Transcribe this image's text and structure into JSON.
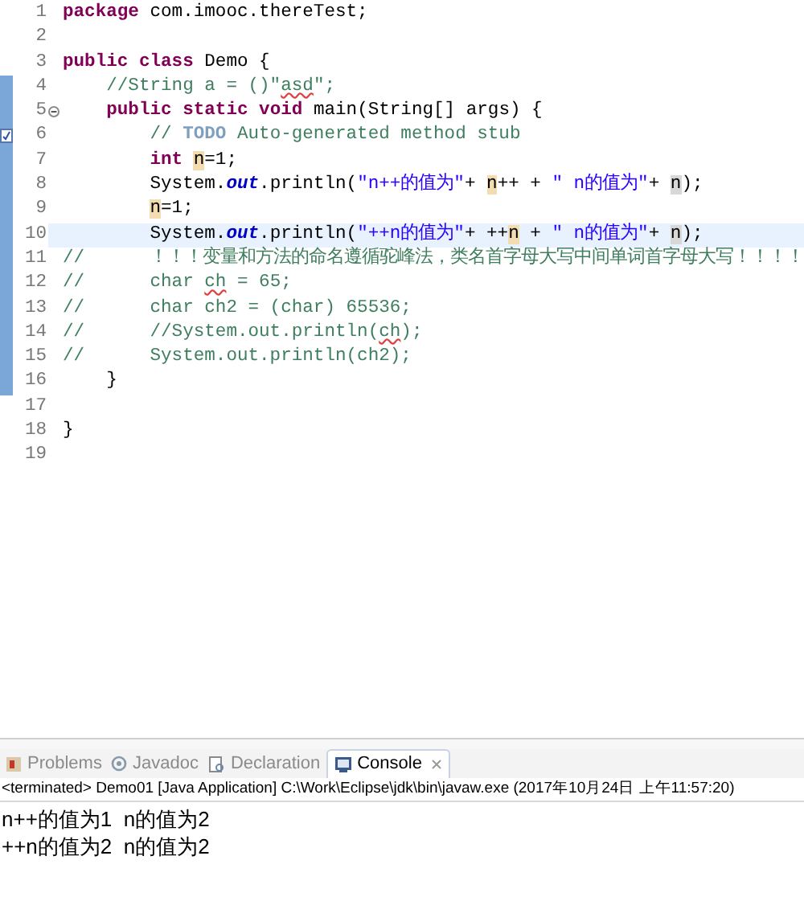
{
  "editor": {
    "lines": [
      {
        "number": "1",
        "changed": false,
        "current": false,
        "fold_toggle": false,
        "task_marker": false,
        "tokens": [
          {
            "kind": "keyword",
            "text": "package"
          },
          {
            "kind": "plain",
            "text": " com.imooc.thereTest;"
          }
        ]
      },
      {
        "number": "2",
        "changed": false,
        "current": false,
        "fold_toggle": false,
        "task_marker": false
      },
      {
        "number": "3",
        "changed": false,
        "current": false,
        "fold_toggle": false,
        "task_marker": false,
        "tokens": [
          {
            "kind": "keyword",
            "text": "public"
          },
          {
            "kind": "keyword",
            "text": " class"
          },
          {
            "kind": "plain",
            "text": " Demo {"
          }
        ]
      },
      {
        "number": "4",
        "changed": true,
        "current": false,
        "fold_toggle": false,
        "task_marker": false,
        "tokens": [
          {
            "kind": "comment",
            "text": "    //String a = ()\""
          },
          {
            "kind": "comment_misspelled",
            "text": "asd"
          },
          {
            "kind": "comment",
            "text": "\";"
          }
        ]
      },
      {
        "number": "5",
        "changed": true,
        "current": false,
        "fold_toggle": true,
        "task_marker": false,
        "tokens": [
          {
            "kind": "keyword",
            "text": "    public"
          },
          {
            "kind": "keyword",
            "text": " static"
          },
          {
            "kind": "keyword",
            "text": " void"
          },
          {
            "kind": "plain",
            "text": " main(String[] args) {"
          }
        ]
      },
      {
        "number": "6",
        "changed": true,
        "current": false,
        "fold_toggle": false,
        "task_marker": true,
        "tokens": [
          {
            "kind": "comment",
            "text": "        // "
          },
          {
            "kind": "todo",
            "text": "TODO"
          },
          {
            "kind": "comment",
            "text": " Auto-generated method stub"
          }
        ]
      },
      {
        "number": "7",
        "changed": true,
        "current": false,
        "fold_toggle": false,
        "task_marker": false,
        "tokens": [
          {
            "kind": "keyword",
            "text": "        int "
          },
          {
            "kind": "occurrence_write",
            "text": "n"
          },
          {
            "kind": "plain",
            "text": "=1;"
          }
        ]
      },
      {
        "number": "8",
        "changed": true,
        "current": false,
        "fold_toggle": false,
        "task_marker": false,
        "tokens": [
          {
            "kind": "plain",
            "text": "        System."
          },
          {
            "kind": "field",
            "text": "out"
          },
          {
            "kind": "plain",
            "text": ".println("
          },
          {
            "kind": "string",
            "text": "\"n++的值为\""
          },
          {
            "kind": "plain",
            "text": "+ "
          },
          {
            "kind": "occurrence_write",
            "text": "n"
          },
          {
            "kind": "plain",
            "text": "++ + "
          },
          {
            "kind": "string",
            "text": "\" n的值为\""
          },
          {
            "kind": "plain",
            "text": "+ "
          },
          {
            "kind": "occurrence_read",
            "text": "n"
          },
          {
            "kind": "plain",
            "text": ");"
          }
        ]
      },
      {
        "number": "9",
        "changed": true,
        "current": false,
        "fold_toggle": false,
        "task_marker": false,
        "tokens": [
          {
            "kind": "occurrence_write",
            "text": "        n"
          },
          {
            "kind": "plain",
            "text": "=1;"
          }
        ]
      },
      {
        "number": "10",
        "changed": true,
        "current": true,
        "fold_toggle": false,
        "task_marker": false,
        "tokens": [
          {
            "kind": "plain",
            "text": "        System."
          },
          {
            "kind": "field",
            "text": "out"
          },
          {
            "kind": "plain",
            "text": ".println("
          },
          {
            "kind": "string",
            "text": "\"++n的值为\""
          },
          {
            "kind": "plain",
            "text": "+ ++"
          },
          {
            "kind": "occurrence_write",
            "text": "n"
          },
          {
            "kind": "plain",
            "text": " + "
          },
          {
            "kind": "string",
            "text": "\" n的值为\""
          },
          {
            "kind": "plain",
            "text": "+ "
          },
          {
            "kind": "occurrence_read",
            "text": "n"
          },
          {
            "kind": "plain",
            "text": ");"
          }
        ]
      },
      {
        "number": "11",
        "changed": true,
        "current": false,
        "fold_toggle": false,
        "task_marker": false,
        "tokens": [
          {
            "kind": "comment",
            "text": "//      ！！！变量和方法的命名遵循驼峰法，类名首字母大写中间单词首字母大写！！！！"
          }
        ]
      },
      {
        "number": "12",
        "changed": true,
        "current": false,
        "fold_toggle": false,
        "task_marker": false,
        "tokens": [
          {
            "kind": "comment",
            "text": "//      char "
          },
          {
            "kind": "comment_misspelled",
            "text": "ch"
          },
          {
            "kind": "comment",
            "text": " = 65;"
          }
        ]
      },
      {
        "number": "13",
        "changed": true,
        "current": false,
        "fold_toggle": false,
        "task_marker": false,
        "tokens": [
          {
            "kind": "comment",
            "text": "//      char ch2 = (char) 65536;"
          }
        ]
      },
      {
        "number": "14",
        "changed": true,
        "current": false,
        "fold_toggle": false,
        "task_marker": false,
        "tokens": [
          {
            "kind": "comment",
            "text": "//      //System.out.println("
          },
          {
            "kind": "comment_misspelled",
            "text": "ch"
          },
          {
            "kind": "comment",
            "text": ");"
          }
        ]
      },
      {
        "number": "15",
        "changed": true,
        "current": false,
        "fold_toggle": false,
        "task_marker": false,
        "tokens": [
          {
            "kind": "comment",
            "text": "//      System.out.println(ch2);"
          }
        ]
      },
      {
        "number": "16",
        "changed": true,
        "current": false,
        "fold_toggle": false,
        "task_marker": false,
        "tokens": [
          {
            "kind": "plain",
            "text": "    }"
          }
        ]
      },
      {
        "number": "17",
        "changed": false,
        "current": false,
        "fold_toggle": false,
        "task_marker": false
      },
      {
        "number": "18",
        "changed": false,
        "current": false,
        "fold_toggle": false,
        "task_marker": false,
        "tokens": [
          {
            "kind": "plain",
            "text": "}"
          }
        ]
      },
      {
        "number": "19",
        "changed": false,
        "current": false,
        "fold_toggle": false,
        "task_marker": false
      }
    ]
  },
  "panel": {
    "tabs": [
      {
        "label": "Problems",
        "selected": false
      },
      {
        "label": "Javadoc",
        "selected": false
      },
      {
        "label": "Declaration",
        "selected": false
      },
      {
        "label": "Console",
        "selected": true
      }
    ],
    "console_header": "<terminated> Demo01 [Java Application] C:\\Work\\Eclipse\\jdk\\bin\\javaw.exe (2017年10月24日 上午11:57:20)",
    "output": [
      "n++的值为1  n的值为2",
      "++n的值为2  n的值为2"
    ]
  }
}
